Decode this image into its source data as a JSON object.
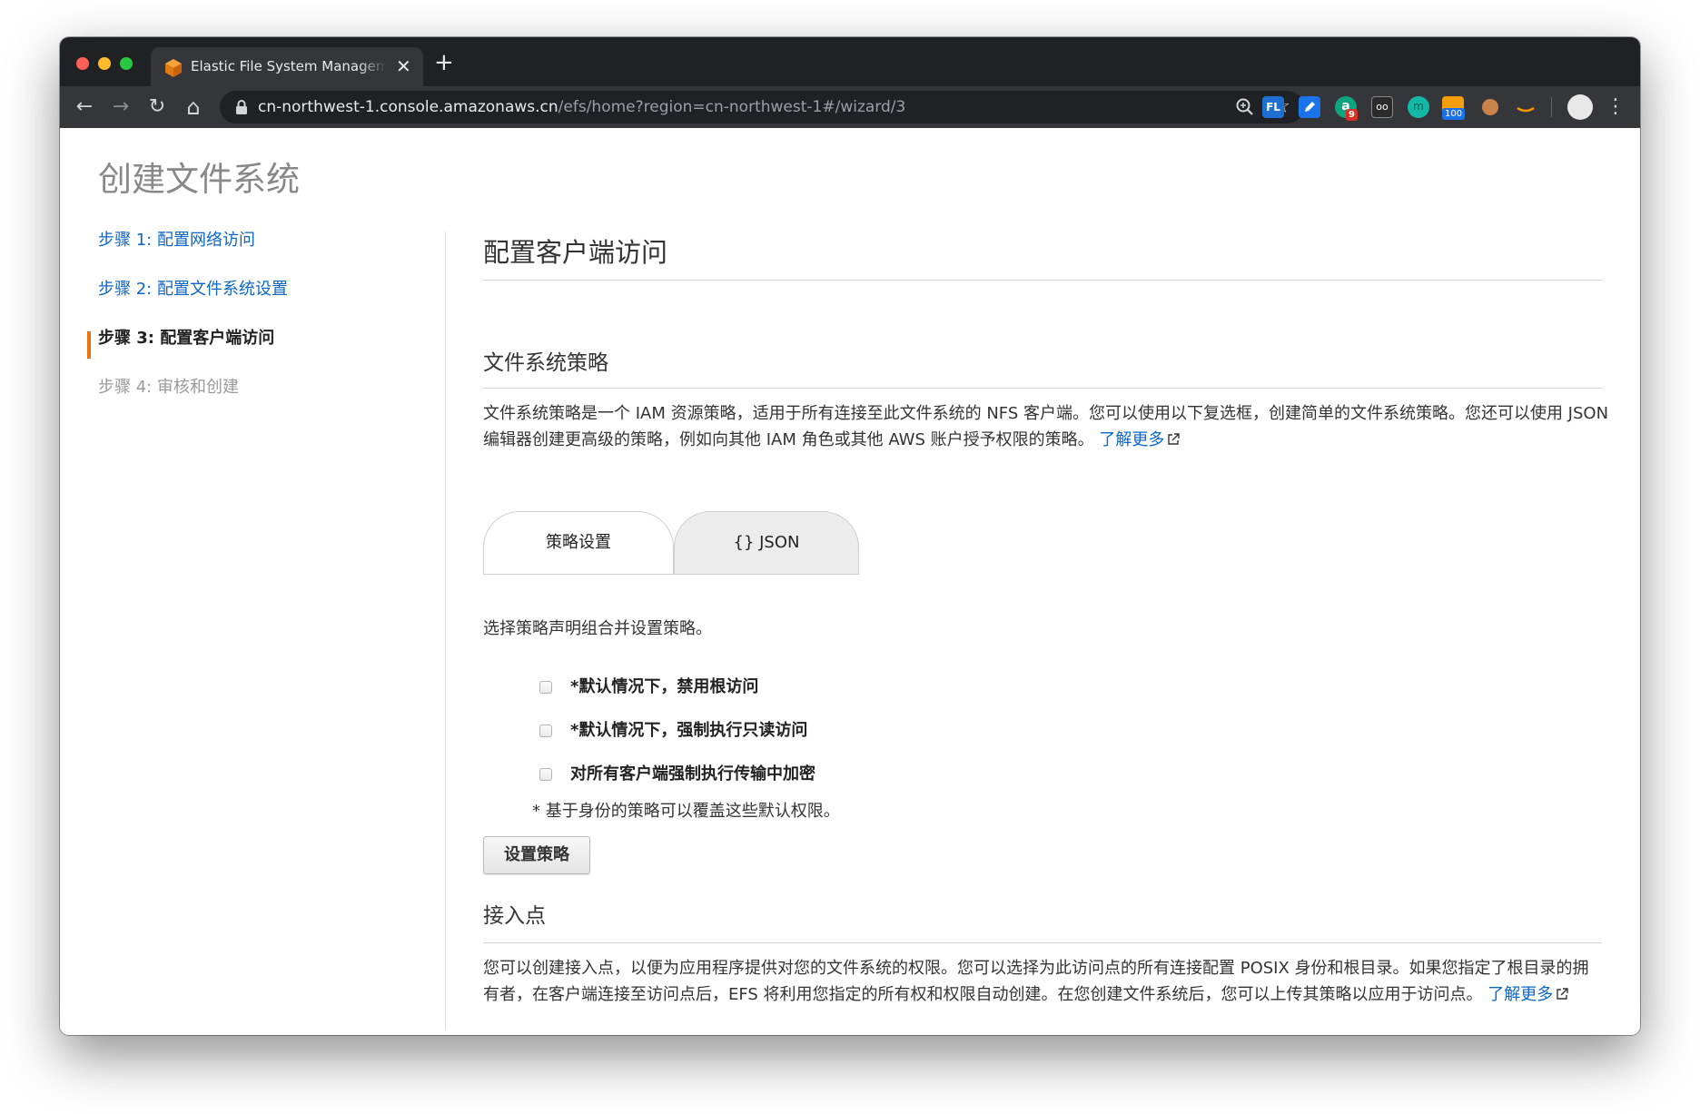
{
  "browser": {
    "tab": {
      "title": "Elastic File System Management Console",
      "close": "✕"
    },
    "new_tab": "+",
    "nav": {
      "back": "←",
      "forward": "→",
      "reload": "↻",
      "home": "⌂"
    },
    "url": {
      "host": "cn-northwest-1.console.amazonaws.cn",
      "path": "/efs/home?region=cn-northwest-1#/wizard/3"
    },
    "omnibox_icons": {
      "zoom": "zoom-icon",
      "bookmark": "☆"
    },
    "extensions": [
      {
        "name": "fl-extension-icon",
        "color": "#1f6fd1",
        "text": "FL"
      },
      {
        "name": "pen-extension-icon",
        "color": "#1a73e8",
        "text": ""
      },
      {
        "name": "grammar-extension-icon",
        "color": "#0fa37f",
        "text": "a",
        "badge": "9"
      },
      {
        "name": "mask-extension-icon",
        "color": "#444444",
        "text": "oo"
      },
      {
        "name": "m-extension-icon",
        "color": "#14b8a6",
        "text": "m"
      },
      {
        "name": "rss-extension-icon",
        "color": "#f59e0b",
        "text": "",
        "badge": "100"
      },
      {
        "name": "cookie-extension-icon",
        "color": "#c9834b",
        "text": ""
      },
      {
        "name": "amazon-extension-icon",
        "color": "#ff9900",
        "text": ""
      }
    ],
    "menu": "⋮"
  },
  "page": {
    "title": "创建文件系统",
    "steps": [
      {
        "label": "步骤 1: 配置网络访问",
        "state": "link"
      },
      {
        "label": "步骤 2: 配置文件系统设置",
        "state": "link"
      },
      {
        "label": "步骤 3: 配置客户端访问",
        "state": "current"
      },
      {
        "label": "步骤 4: 审核和创建",
        "state": "disabled"
      }
    ],
    "main": {
      "heading": "配置客户端访问",
      "policy_section": {
        "heading": "文件系统策略",
        "description": "文件系统策略是一个 IAM 资源策略，适用于所有连接至此文件系统的 NFS 客户端。您可以使用以下复选框，创建简单的文件系统策略。您还可以使用 JSON 编辑器创建更高级的策略，例如向其他 IAM 角色或其他 AWS 账户授予权限的策略。",
        "learn_more": "了解更多",
        "tabs": [
          "策略设置",
          "{} JSON"
        ],
        "instruction": "选择策略声明组合并设置策略。",
        "options": [
          {
            "label": "*默认情况下，禁用根访问",
            "checked": false
          },
          {
            "label": "*默认情况下，强制执行只读访问",
            "checked": false
          },
          {
            "label": "对所有客户端强制执行传输中加密",
            "checked": false
          }
        ],
        "footnote": "* 基于身份的策略可以覆盖这些默认权限。",
        "button": "设置策略"
      },
      "access_point_section": {
        "heading": "接入点",
        "description": "您可以创建接入点，以便为应用程序提供对您的文件系统的权限。您可以选择为此访问点的所有连接配置 POSIX 身份和根目录。如果您指定了根目录的拥有者，在客户端连接至访问点后，EFS 将利用您指定的所有权和权限自动创建。在您创建文件系统后，您可以上传其策略以应用于访问点。",
        "learn_more": "了解更多"
      }
    },
    "colors": {
      "link": "#0b66c8",
      "step_indicator": "#ec7211",
      "aws_orange": "#f08c1a"
    }
  }
}
